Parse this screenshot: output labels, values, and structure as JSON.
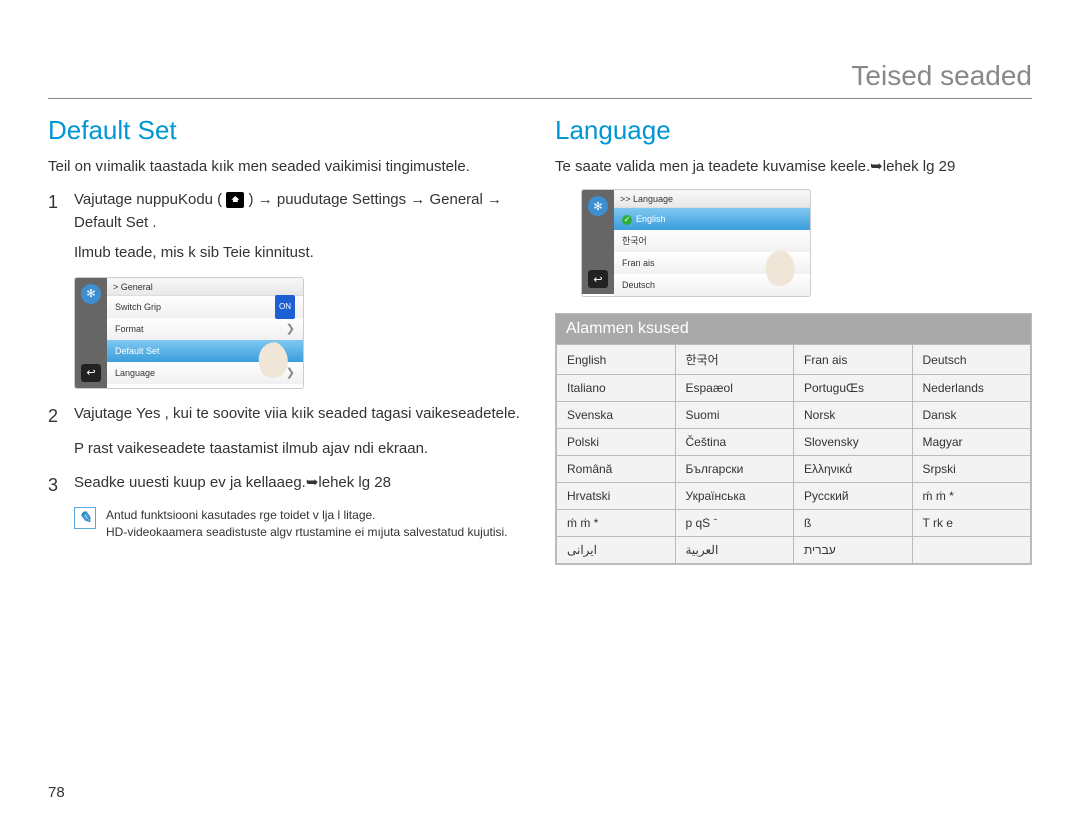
{
  "page": {
    "number": "78"
  },
  "header": {
    "title": "Teised seaded"
  },
  "left": {
    "title": "Default Set",
    "intro": "Teil on vıimalik taastada kıik men  seaded vaikimisi tingimustele.",
    "step1_pre": "Vajutage nuppuKodu (",
    "step1_post": ") → puudutage  Settings   →   General   →   Default Set  .",
    "step1_sub": "Ilmub teade, mis k sib Teie kinnitust.",
    "step2": "Vajutage  Yes , kui te soovite viia kıik seaded tagasi vaikeseadetele.",
    "step2_sub": "P rast vaikeseadete taastamist ilmub ajav  ndi ekraan.",
    "step3": "Seadke uuesti kuup ev ja kellaaeg.➥lehek lg 28",
    "note1": "Antud funktsiooni kasutades  rge toidet v lja l litage.",
    "note2": "HD-videokaamera seadistuste algv rtustamine ei mıjuta salvestatud kujutisi.",
    "lcd_general": {
      "breadcrumb": "> General",
      "items": [
        "Switch Grip",
        "Format",
        "Default Set",
        "Language"
      ],
      "on_badge": "ON"
    }
  },
  "right": {
    "title": "Language",
    "intro": "Te saate valida men   ja teadete kuvamise keele.➥lehek lg 29",
    "lcd_language": {
      "breadcrumb": ">> Language",
      "items": [
        "English",
        "한국어",
        "Fran ais",
        "Deutsch"
      ]
    },
    "subhead": "Alammen    ksused",
    "languages": [
      [
        "English",
        "한국어",
        "Fran ais",
        "Deutsch"
      ],
      [
        "Italiano",
        "Espaæol",
        "PortuguŒs",
        "Nederlands"
      ],
      [
        "Svenska",
        "Suomi",
        "Norsk",
        "Dansk"
      ],
      [
        "Polski",
        "Čeština",
        "Slovensky",
        "Magyar"
      ],
      [
        "Română",
        "Български",
        "Ελληνικά",
        "Srpski"
      ],
      [
        "Hrvatski",
        "Українська",
        "Русский",
        "ḿ    ṁ     *"
      ],
      [
        "ḿ    ṁ     *",
        "p qS ˉ",
        "ß",
        "T rk e"
      ],
      [
        "ایرانی",
        "العربية",
        "עברית",
        ""
      ]
    ]
  }
}
